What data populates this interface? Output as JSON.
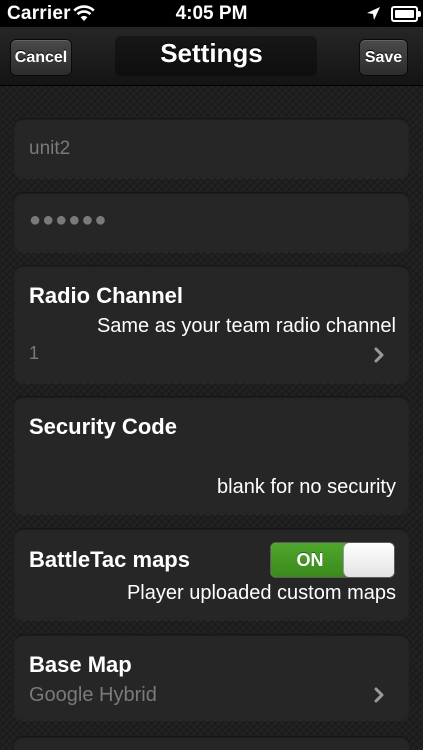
{
  "status_bar": {
    "carrier": "Carrier",
    "time": "4:05 PM"
  },
  "nav": {
    "title": "Settings",
    "cancel_label": "Cancel",
    "save_label": "Save"
  },
  "fields": {
    "username_value": "unit2",
    "password_masked": "●●●●●●"
  },
  "radio_channel": {
    "label": "Radio Channel",
    "description": "Same as your team radio channel",
    "value": "1"
  },
  "security_code": {
    "label": "Security Code",
    "description": "blank for no security"
  },
  "battletac_maps": {
    "label": "BattleTac maps",
    "toggle_state": "ON",
    "description": "Player uploaded custom maps"
  },
  "base_map": {
    "label": "Base Map",
    "value": "Google Hybrid"
  },
  "icons": [
    "wifi-icon",
    "location-icon",
    "battery-icon",
    "chevron-right-icon"
  ],
  "colors": {
    "background": "#1e1e1e",
    "cell": "#262626",
    "toggle_on": "#4fa62c",
    "muted_text": "#7a7a7a"
  }
}
